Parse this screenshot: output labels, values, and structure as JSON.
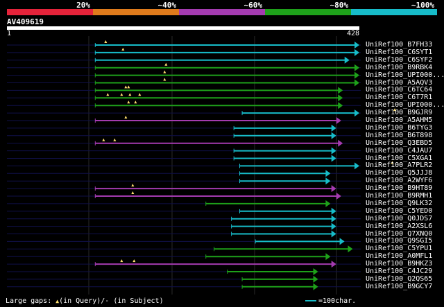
{
  "legend": {
    "labels": [
      "20%",
      "~40%",
      "~60%",
      "~80%",
      "~100%"
    ],
    "colors": [
      "#e5233a",
      "#df7b1c",
      "#a43bb0",
      "#1ea11a",
      "#17bcc9"
    ]
  },
  "query": {
    "title": "AV409619",
    "start": "1",
    "end": "428",
    "length": 428
  },
  "hits": [
    {
      "name": "UniRef100_B7FH33",
      "start": 108,
      "end": 428,
      "color": "#17bcc9",
      "gaps": [
        15
      ]
    },
    {
      "name": "UniRef100_C6SYT1",
      "start": 108,
      "end": 428,
      "color": "#17bcc9",
      "gaps": [
        40
      ]
    },
    {
      "name": "UniRef100_C6SYF2",
      "start": 108,
      "end": 416,
      "color": "#17bcc9",
      "gaps": []
    },
    {
      "name": "UniRef100_B9RBK4",
      "start": 108,
      "end": 428,
      "color": "#1ea11a",
      "gaps": [
        102
      ]
    },
    {
      "name": "UniRef100_UPI000...",
      "start": 108,
      "end": 428,
      "color": "#1ea11a",
      "gaps": [
        100
      ]
    },
    {
      "name": "UniRef100_A5AQV3",
      "start": 108,
      "end": 428,
      "color": "#1ea11a",
      "gaps": [
        100
      ]
    },
    {
      "name": "UniRef100_C6TC64",
      "start": 108,
      "end": 408,
      "color": "#1ea11a",
      "gaps": [
        44,
        48
      ]
    },
    {
      "name": "UniRef100_C6T7R1",
      "start": 108,
      "end": 408,
      "color": "#1ea11a",
      "gaps": [
        18,
        38,
        50,
        64
      ]
    },
    {
      "name": "UniRef100_UPI000...",
      "start": 108,
      "end": 408,
      "color": "#1ea11a",
      "gaps": [
        48,
        58
      ]
    },
    {
      "name": "UniRef100_B9GJR9",
      "start": 286,
      "end": 428,
      "color": "#17bcc9",
      "gaps": [
        220
      ]
    },
    {
      "name": "UniRef100_A5AHM5",
      "start": 108,
      "end": 406,
      "color": "#a43bb0",
      "gaps": [
        44
      ]
    },
    {
      "name": "UniRef100_B6TYG3",
      "start": 276,
      "end": 400,
      "color": "#17bcc9",
      "gaps": []
    },
    {
      "name": "UniRef100_B6T898",
      "start": 276,
      "end": 400,
      "color": "#17bcc9",
      "gaps": []
    },
    {
      "name": "UniRef100_Q3EBD5",
      "start": 108,
      "end": 408,
      "color": "#a43bb0",
      "gaps": [
        12,
        28
      ]
    },
    {
      "name": "UniRef100_C4JAU7",
      "start": 276,
      "end": 400,
      "color": "#17bcc9",
      "gaps": []
    },
    {
      "name": "UniRef100_C5XGA1",
      "start": 276,
      "end": 400,
      "color": "#17bcc9",
      "gaps": []
    },
    {
      "name": "UniRef100_A7PLR2",
      "start": 283,
      "end": 428,
      "color": "#17bcc9",
      "gaps": [
        220
      ]
    },
    {
      "name": "UniRef100_Q5JJJ8",
      "start": 283,
      "end": 393,
      "color": "#17bcc9",
      "gaps": []
    },
    {
      "name": "UniRef100_A2WYF6",
      "start": 283,
      "end": 393,
      "color": "#17bcc9",
      "gaps": []
    },
    {
      "name": "UniRef100_B9HT89",
      "start": 108,
      "end": 400,
      "color": "#a43bb0",
      "gaps": [
        54
      ]
    },
    {
      "name": "UniRef100_B9RMH1",
      "start": 108,
      "end": 406,
      "color": "#a43bb0",
      "gaps": [
        54
      ]
    },
    {
      "name": "UniRef100_Q9LK32",
      "start": 242,
      "end": 393,
      "color": "#1ea11a",
      "gaps": []
    },
    {
      "name": "UniRef100_C5YED0",
      "start": 283,
      "end": 400,
      "color": "#17bcc9",
      "gaps": []
    },
    {
      "name": "UniRef100_Q0JDS7",
      "start": 273,
      "end": 400,
      "color": "#17bcc9",
      "gaps": []
    },
    {
      "name": "UniRef100_A2XSL6",
      "start": 273,
      "end": 400,
      "color": "#17bcc9",
      "gaps": []
    },
    {
      "name": "UniRef100_Q7XNQ0",
      "start": 273,
      "end": 400,
      "color": "#17bcc9",
      "gaps": []
    },
    {
      "name": "UniRef100_Q9SGI5",
      "start": 302,
      "end": 410,
      "color": "#17bcc9",
      "gaps": []
    },
    {
      "name": "UniRef100_C5YPU1",
      "start": 252,
      "end": 420,
      "color": "#1ea11a",
      "gaps": []
    },
    {
      "name": "UniRef100_A0MFL1",
      "start": 242,
      "end": 393,
      "color": "#1ea11a",
      "gaps": []
    },
    {
      "name": "UniRef100_B9HKZ3",
      "start": 108,
      "end": 400,
      "color": "#a43bb0",
      "gaps": [
        38,
        56
      ]
    },
    {
      "name": "UniRef100_C4JC29",
      "start": 268,
      "end": 378,
      "color": "#1ea11a",
      "gaps": []
    },
    {
      "name": "UniRef100_Q2QS65",
      "start": 286,
      "end": 378,
      "color": "#1ea11a",
      "gaps": []
    },
    {
      "name": "UniRef100_B9GCY7",
      "start": 286,
      "end": 378,
      "color": "#1ea11a",
      "gaps": []
    }
  ],
  "footer": {
    "gaps_prefix": "Large gaps: ",
    "gaps_mid": "(in Query)/- (in Subject)",
    "scale": "=100char."
  }
}
